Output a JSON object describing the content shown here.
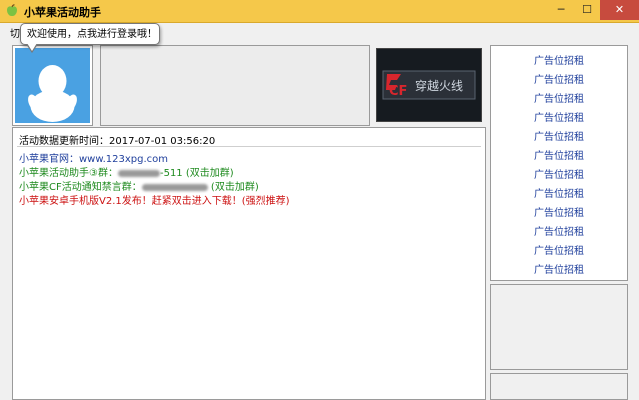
{
  "window": {
    "title": "小苹果活动助手",
    "minimize_glyph": "─",
    "maximize_glyph": "☐",
    "close_glyph": "✕",
    "icon": "apple-icon",
    "title_bar_color": "#f5c84a",
    "close_color": "#c74b3e"
  },
  "menu": {
    "first_item": "切"
  },
  "tooltip": {
    "text": "欢迎使用，点我进行登录哦！"
  },
  "avatar": {
    "icon": "qq-penguin-icon",
    "color": "#4aa1e2"
  },
  "game_logo": {
    "icon": "crossfire-logo-icon",
    "cf_text": "CF",
    "logo_text": "穿越火线"
  },
  "content": {
    "update_label": "活动数据更新时间：",
    "update_time": "2017-07-01 03:56:20",
    "items": [
      {
        "text": "小苹果官网：www.123xpg.com",
        "color": "#1f3f9c"
      },
      {
        "prefix": "小苹果活动助手③群：",
        "visible_suffix": "-511 (双击加群)",
        "color": "#1e8a1e"
      },
      {
        "prefix": "小苹果CF活动通知禁言群：",
        "visible_suffix": " (双击加群)",
        "color": "#1e8a1e"
      },
      {
        "text": "小苹果安卓手机版V2.1发布！赶紧双击进入下载！(强烈推荐)",
        "color": "#cc1111"
      }
    ]
  },
  "ads": {
    "items": [
      "广告位招租",
      "广告位招租",
      "广告位招租",
      "广告位招租",
      "广告位招租",
      "广告位招租",
      "广告位招租",
      "广告位招租",
      "广告位招租",
      "广告位招租",
      "广告位招租",
      "广告位招租"
    ],
    "color": "#1f3f9c"
  }
}
